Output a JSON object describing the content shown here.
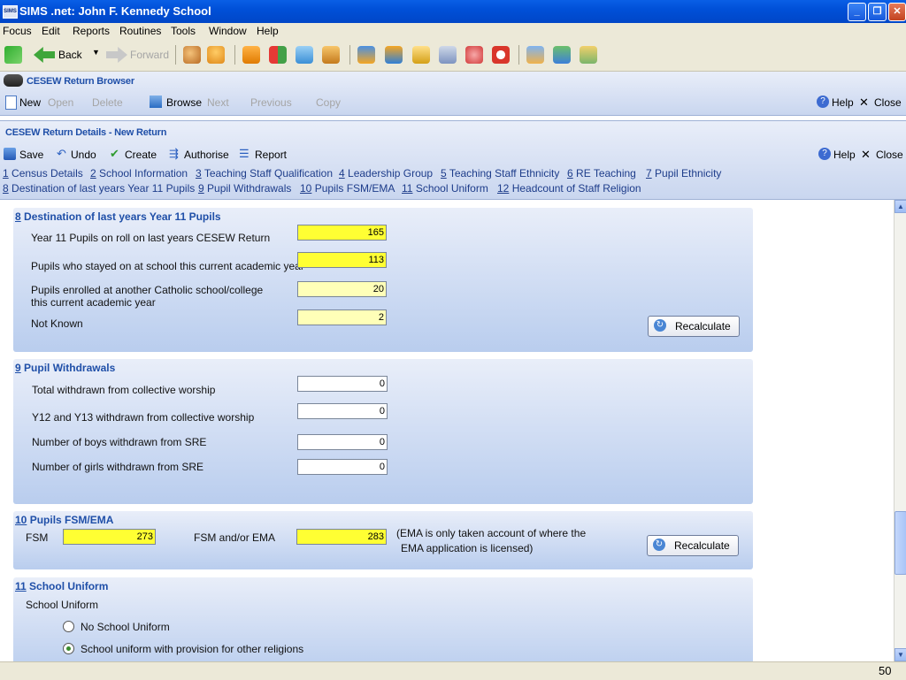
{
  "window": {
    "logo_text": "SIMS",
    "title": "SIMS .net: John F. Kennedy School"
  },
  "menu": [
    "Focus",
    "Edit",
    "Reports",
    "Routines",
    "Tools",
    "Window",
    "Help"
  ],
  "toolbar": {
    "back": "Back",
    "forward": "Forward"
  },
  "browser": {
    "title": "CESEW Return Browser",
    "new": "New",
    "open": "Open",
    "delete": "Delete",
    "browse": "Browse",
    "next": "Next",
    "previous": "Previous",
    "copy": "Copy",
    "help": "Help",
    "close": "Close"
  },
  "details": {
    "title": "CESEW Return Details - New Return",
    "save": "Save",
    "undo": "Undo",
    "create": "Create",
    "authorise": "Authorise",
    "report": "Report",
    "help": "Help",
    "close": "Close",
    "links_row1": [
      {
        "num": "1",
        "text": "Census Details"
      },
      {
        "num": "2",
        "text": "School Information"
      },
      {
        "num": "3",
        "text": "Teaching Staff Qualification"
      },
      {
        "num": "4",
        "text": "Leadership Group"
      },
      {
        "num": "5",
        "text": "Teaching Staff Ethnicity"
      },
      {
        "num": "6",
        "text": "RE Teaching"
      },
      {
        "num": "7",
        "text": "Pupil Ethnicity"
      }
    ],
    "links_row2": [
      {
        "num": "8",
        "text": "Destination of last years Year 11 Pupils"
      },
      {
        "num": "9",
        "text": "Pupil Withdrawals"
      },
      {
        "num": "10",
        "text": "Pupils FSM/EMA"
      },
      {
        "num": "11",
        "text": "School Uniform"
      },
      {
        "num": "12",
        "text": "Headcount of Staff Religion"
      }
    ]
  },
  "section8": {
    "num": "8",
    "title": "Destination of last years Year 11 Pupils",
    "rows": [
      {
        "label": "Year 11 Pupils on roll on last years CESEW Return",
        "value": "165"
      },
      {
        "label": "Pupils who stayed on at school this current academic year",
        "value": "113"
      },
      {
        "label": "Pupils enrolled at another Catholic school/college",
        "label2": "this current academic year",
        "value": "20"
      },
      {
        "label": "Not Known",
        "value": "2"
      }
    ],
    "recalc": "Recalculate"
  },
  "section9": {
    "num": "9",
    "title": "Pupil Withdrawals",
    "rows": [
      {
        "label": "Total withdrawn from collective worship",
        "value": "0"
      },
      {
        "label": "Y12 and Y13 withdrawn from collective worship",
        "value": "0"
      },
      {
        "label": "Number of boys withdrawn from SRE",
        "value": "0"
      },
      {
        "label": "Number of girls withdrawn from SRE",
        "value": "0"
      }
    ]
  },
  "section10": {
    "num": "10",
    "title": "Pupils FSM/EMA",
    "fsm_label": "FSM",
    "fsm_value": "273",
    "ema_label": "FSM and/or EMA",
    "ema_value": "283",
    "note1": "(EMA is only taken account of where the",
    "note2": "EMA application is licensed)",
    "recalc": "Recalculate"
  },
  "section11": {
    "num": "11",
    "title": "School Uniform",
    "label": "School Uniform",
    "options": [
      "No School Uniform",
      "School uniform with provision for other religions"
    ],
    "selected_index": 1
  },
  "status": {
    "right": "50"
  },
  "colors": {
    "required": "#ffff33",
    "calculated": "#ffffb8",
    "title_blue": "#1f4fa8"
  }
}
